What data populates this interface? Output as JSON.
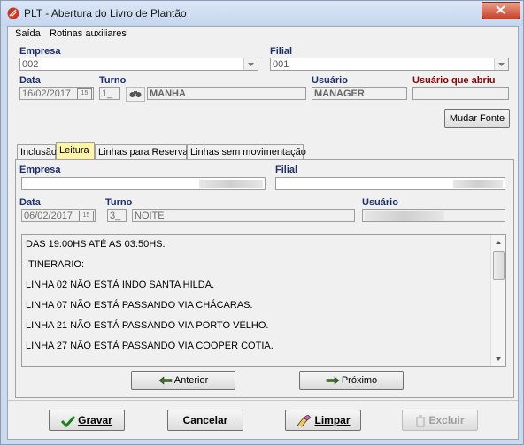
{
  "window": {
    "title": "PLT - Abertura do Livro de Plantão"
  },
  "menu": {
    "items": [
      "Saída",
      "Rotinas auxiliares"
    ]
  },
  "top": {
    "empresa_label": "Empresa",
    "empresa_value": "002",
    "filial_label": "Filial",
    "filial_value": "001",
    "data_label": "Data",
    "data_value": "16/02/2017",
    "turno_label": "Turno",
    "turno_code": "1_",
    "turno_name": "MANHA",
    "usuario_label": "Usuário",
    "usuario_value": "MANAGER",
    "usuario_abriu_label": "Usuário que abriu",
    "usuario_abriu_value": "",
    "mudar_fonte": "Mudar Fonte"
  },
  "tabs": [
    "Inclusão",
    "Leitura",
    "Linhas para Reserva",
    "Linhas sem movimentação"
  ],
  "active_tab": "Leitura",
  "reading": {
    "empresa_label": "Empresa",
    "filial_label": "Filial",
    "data_label": "Data",
    "data_value": "06/02/2017",
    "turno_label": "Turno",
    "turno_code": "3_",
    "turno_name": "NOITE",
    "usuario_label": "Usuário",
    "lines": [
      "DAS 19:00HS ATÉ AS 03:50HS.",
      "ITINERARIO:",
      "LINHA 02 NÃO ESTÁ INDO SANTA HILDA.",
      "LINHA 07 NÃO ESTÁ PASSANDO VIA CHÁCARAS.",
      "LINHA 21 NÃO ESTÁ PASSANDO VIA PORTO VELHO.",
      "LINHA 27 NÃO ESTÁ PASSANDO VIA COOPER COTIA."
    ],
    "anterior": "Anterior",
    "proximo": "Próximo"
  },
  "actions": {
    "gravar": "Gravar",
    "cancelar": "Cancelar",
    "limpar": "Limpar",
    "excluir": "Excluir"
  },
  "colors": {
    "label_blue": "#1c2f6b",
    "label_red": "#8b0000",
    "tab_active": "#fff5a8"
  }
}
